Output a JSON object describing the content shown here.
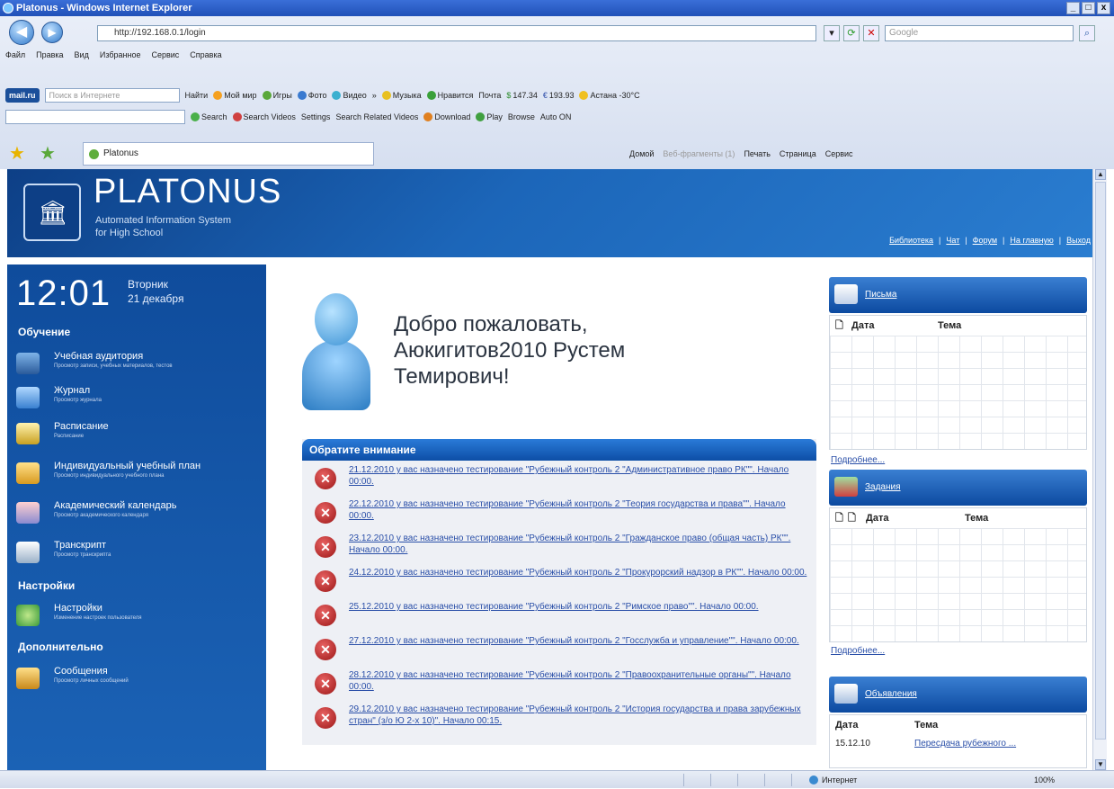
{
  "window": {
    "title": "Platonus - Windows Internet Explorer",
    "controls": [
      "_",
      "□",
      "x"
    ]
  },
  "browser": {
    "url": "http://192.168.0.1/login",
    "search_placeholder": "Google",
    "menu": [
      "Файл",
      "Правка",
      "Вид",
      "Избранное",
      "Сервис",
      "Справка"
    ],
    "toolbar1": {
      "brand": "mail.ru",
      "search_placeholder": "Поиск в Интернете",
      "find": "Найти",
      "items": [
        "Мой мир",
        "Игры",
        "Фото",
        "Видео",
        "»",
        "Музыка",
        "Нравится",
        "Почта",
        "147.34",
        "193.93",
        "Астана -30°C"
      ]
    },
    "toolbar2": {
      "items": [
        "Search",
        "Search Videos",
        "Settings",
        "Search Related Videos",
        "Download",
        "Play",
        "Browse",
        "Auto ON"
      ]
    },
    "tab_title": "Platonus",
    "command_bar": [
      "Домой",
      "Веб-фрагменты (1)",
      "Печать",
      "Страница",
      "Сервис"
    ]
  },
  "header": {
    "brand": "PLATONUS",
    "sub1": "Automated Information System",
    "sub2": "for High School",
    "links": [
      "Библиотека",
      "Чат",
      "Форум",
      "На главную",
      "Выход"
    ],
    "separator": "|"
  },
  "sidebar": {
    "time": "12:01",
    "weekday": "Вторник",
    "date": "21 декабря",
    "sections": [
      {
        "title": "Обучение",
        "items": [
          {
            "label": "Учебная аудитория",
            "sub": "Просмотр записи, учебных материалов, тестов"
          },
          {
            "label": "Журнал",
            "sub": "Просмотр журнала"
          },
          {
            "label": "Расписание",
            "sub": "Расписание"
          },
          {
            "label": "Индивидуальный учебный план",
            "sub": "Просмотр индивидуального учебного плана"
          },
          {
            "label": "Академический календарь",
            "sub": "Просмотр академического календаря"
          },
          {
            "label": "Транскрипт",
            "sub": "Просмотр транскрипта"
          }
        ]
      },
      {
        "title": "Настройки",
        "items": [
          {
            "label": "Настройки",
            "sub": "Изменение настроек пользователя"
          }
        ]
      },
      {
        "title": "Дополнительно",
        "items": [
          {
            "label": "Сообщения",
            "sub": "Просмотр личных сообщений"
          }
        ]
      }
    ]
  },
  "main": {
    "welcome": "Добро пожаловать, Аюкигитов2010 Рустем Темирович!",
    "notice_title": "Обратите внимание",
    "notices": [
      "21.12.2010 у вас назначено тестирование \"Рубежный контроль 2 \"Административное право РК\"\". Начало 00:00.",
      "22.12.2010 у вас назначено тестирование \"Рубежный контроль 2 \"Теория государства и права\"\". Начало 00:00.",
      "23.12.2010 у вас назначено тестирование \"Рубежный контроль 2 \"Гражданское право (общая часть) РК\"\". Начало 00:00.",
      "24.12.2010 у вас назначено тестирование \"Рубежный контроль 2 \"Прокурорский надзор в РК\"\". Начало 00:00.",
      "25.12.2010 у вас назначено тестирование \"Рубежный контроль 2 \"Римское право\"\". Начало 00:00.",
      "27.12.2010 у вас назначено тестирование \"Рубежный контроль 2 \"Госслужба и управление\"\". Начало 00:00.",
      "28.12.2010 у вас назначено тестирование \"Рубежный контроль 2 \"Правоохранительные органы\"\". Начало 00:00.",
      "29.12.2010 у вас назначено тестирование \"Рубежный контроль 2 \"История государства и права зарубежных стран\" (з/о Ю 2-х 10)\". Начало 00:15."
    ]
  },
  "right": {
    "letters": {
      "title": "Письма",
      "col_date": "Дата",
      "col_topic": "Тема",
      "more": "Подробнее..."
    },
    "tasks": {
      "title": "Задания",
      "col_date": "Дата",
      "col_topic": "Тема",
      "more": "Подробнее..."
    },
    "ads": {
      "title": "Объявления",
      "col_date": "Дата",
      "col_topic": "Тема",
      "row_date": "15.12.10",
      "row_topic": "Пересдача рубежного ..."
    }
  },
  "status": {
    "zone": "Интернет",
    "zoom": "100%"
  }
}
